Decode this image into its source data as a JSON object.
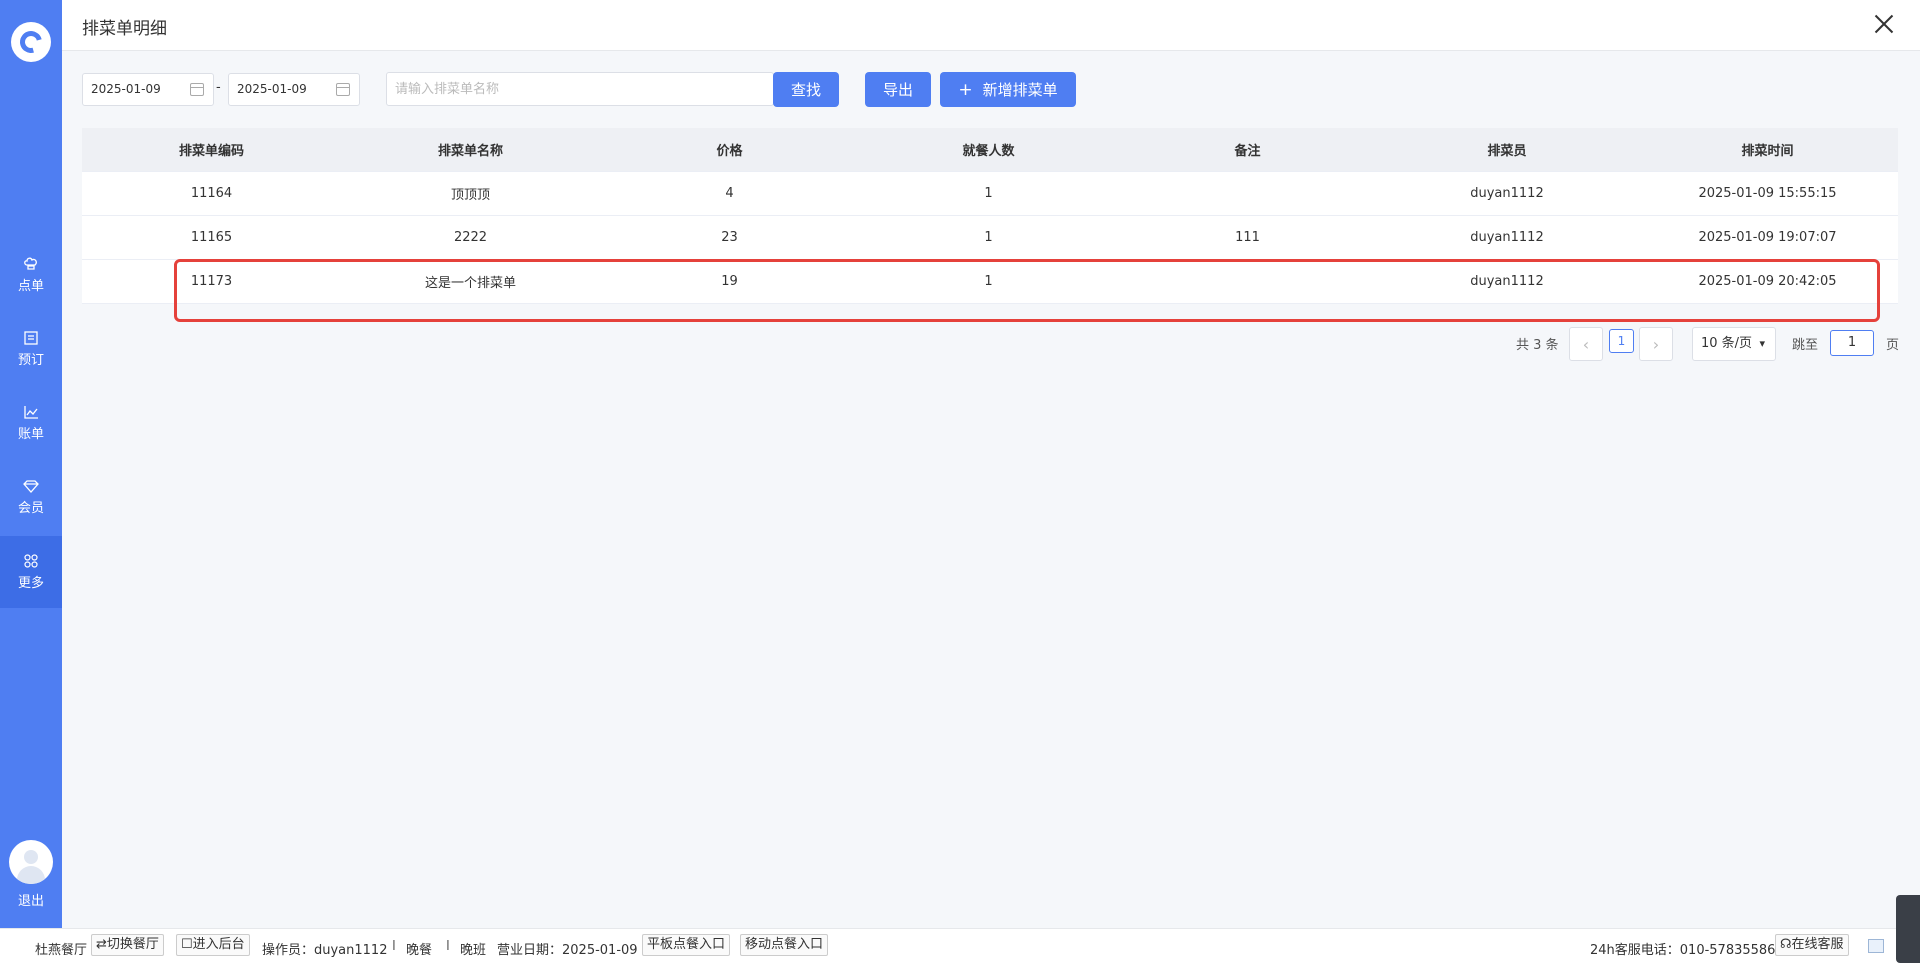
{
  "sidebar": {
    "items": [
      {
        "label": "点单",
        "icon": "chef-hat-icon"
      },
      {
        "label": "预订",
        "icon": "calendar-book-icon"
      },
      {
        "label": "账单",
        "icon": "chart-icon"
      },
      {
        "label": "会员",
        "icon": "diamond-icon"
      },
      {
        "label": "更多",
        "icon": "grid-icon",
        "active": true
      }
    ],
    "logout_label": "退出"
  },
  "header": {
    "title": "排菜单明细"
  },
  "filters": {
    "start_date": "2025-01-09",
    "end_date": "2025-01-09",
    "date_separator": "-",
    "search_placeholder": "请输入排菜单名称",
    "search_button": "查找",
    "export_button": "导出",
    "add_button": "新增排菜单"
  },
  "table": {
    "columns": [
      "排菜单编码",
      "排菜单名称",
      "价格",
      "就餐人数",
      "备注",
      "排菜员",
      "排菜时间"
    ],
    "rows": [
      [
        "11164",
        "顶顶顶",
        "4",
        "1",
        "",
        "duyan1112",
        "2025-01-09 15:55:15"
      ],
      [
        "11165",
        "2222",
        "23",
        "1",
        "111",
        "duyan1112",
        "2025-01-09 19:07:07"
      ],
      [
        "11173",
        "这是一个排菜单",
        "19",
        "1",
        "",
        "duyan1112",
        "2025-01-09 20:42:05"
      ]
    ]
  },
  "pagination": {
    "total_text": "共 3 条",
    "prev": "‹",
    "next": "›",
    "current_page": "1",
    "page_size": "10 条/页",
    "jump_label": "跳至",
    "jump_value": "1",
    "page_suffix": "页"
  },
  "statusbar": {
    "restaurant": "杜燕餐厅",
    "switch_restaurant": "⇄切换餐厅",
    "enter_backend": "☐进入后台",
    "operator": "操作员：duyan1112",
    "separator": "I",
    "meal": "晚餐",
    "shift": "晚班",
    "business_date": "营业日期：2025-01-09",
    "tablet_entry": "平板点餐入口",
    "mobile_entry": "移动点餐入口",
    "hotline": "24h客服电话：010-57835586",
    "online_service": "在线客服"
  },
  "colors": {
    "primary": "#4f7ef2",
    "highlight": "#e5413b"
  }
}
